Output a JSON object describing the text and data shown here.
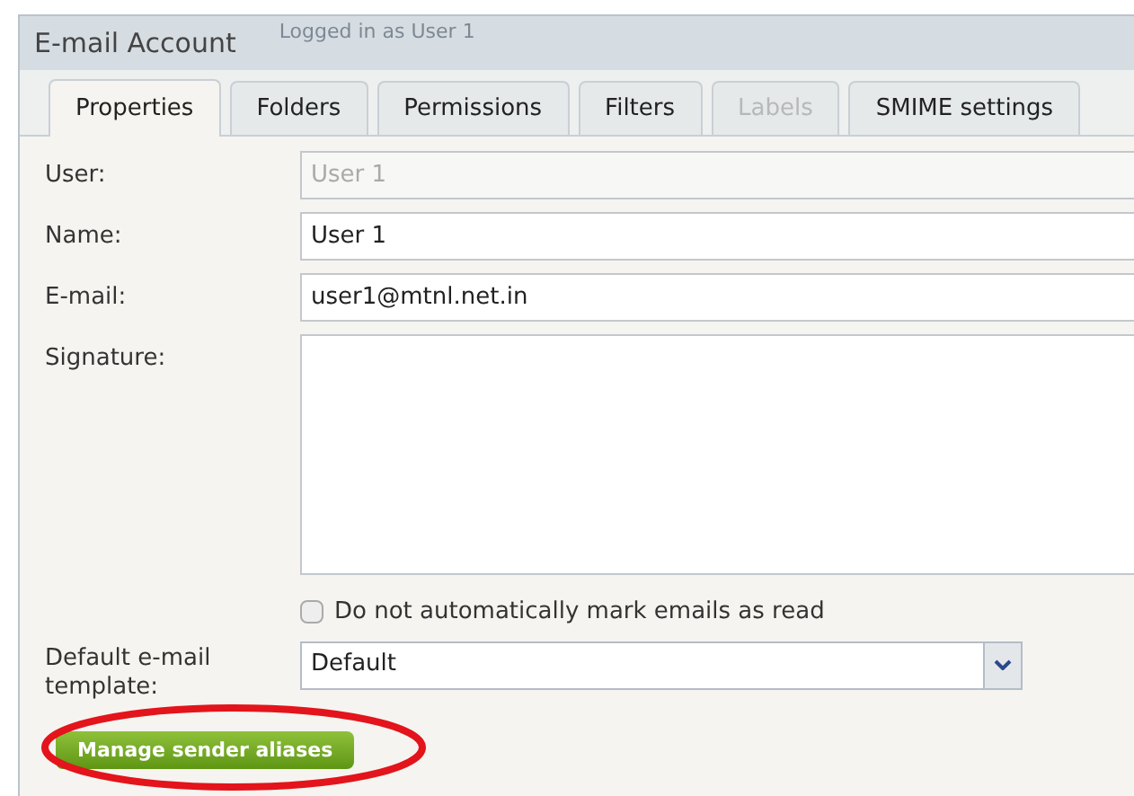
{
  "background": {
    "status": "Logged in as User 1"
  },
  "window": {
    "title": "E-mail Account"
  },
  "tabs": [
    {
      "label": "Properties",
      "selected": true,
      "disabled": false
    },
    {
      "label": "Folders",
      "selected": false,
      "disabled": false
    },
    {
      "label": "Permissions",
      "selected": false,
      "disabled": false
    },
    {
      "label": "Filters",
      "selected": false,
      "disabled": false
    },
    {
      "label": "Labels",
      "selected": false,
      "disabled": true
    },
    {
      "label": "SMIME settings",
      "selected": false,
      "disabled": false
    }
  ],
  "fields": [
    {
      "kind": "text",
      "label": "User:",
      "value": "User 1",
      "disabled": true
    },
    {
      "kind": "text",
      "label": "Name:",
      "value": "User 1",
      "disabled": false
    },
    {
      "kind": "text",
      "label": "E-mail:",
      "value": "user1@mtnl.net.in",
      "disabled": false
    },
    {
      "kind": "textarea",
      "label": "Signature:"
    }
  ],
  "mark_as_read": {
    "label": "Do not automatically mark emails as read",
    "checked": false
  },
  "template": {
    "label": "Default e-mail template:",
    "value": "Default"
  },
  "aliases_button": {
    "label": "Manage sender aliases",
    "highlighted": true
  }
}
